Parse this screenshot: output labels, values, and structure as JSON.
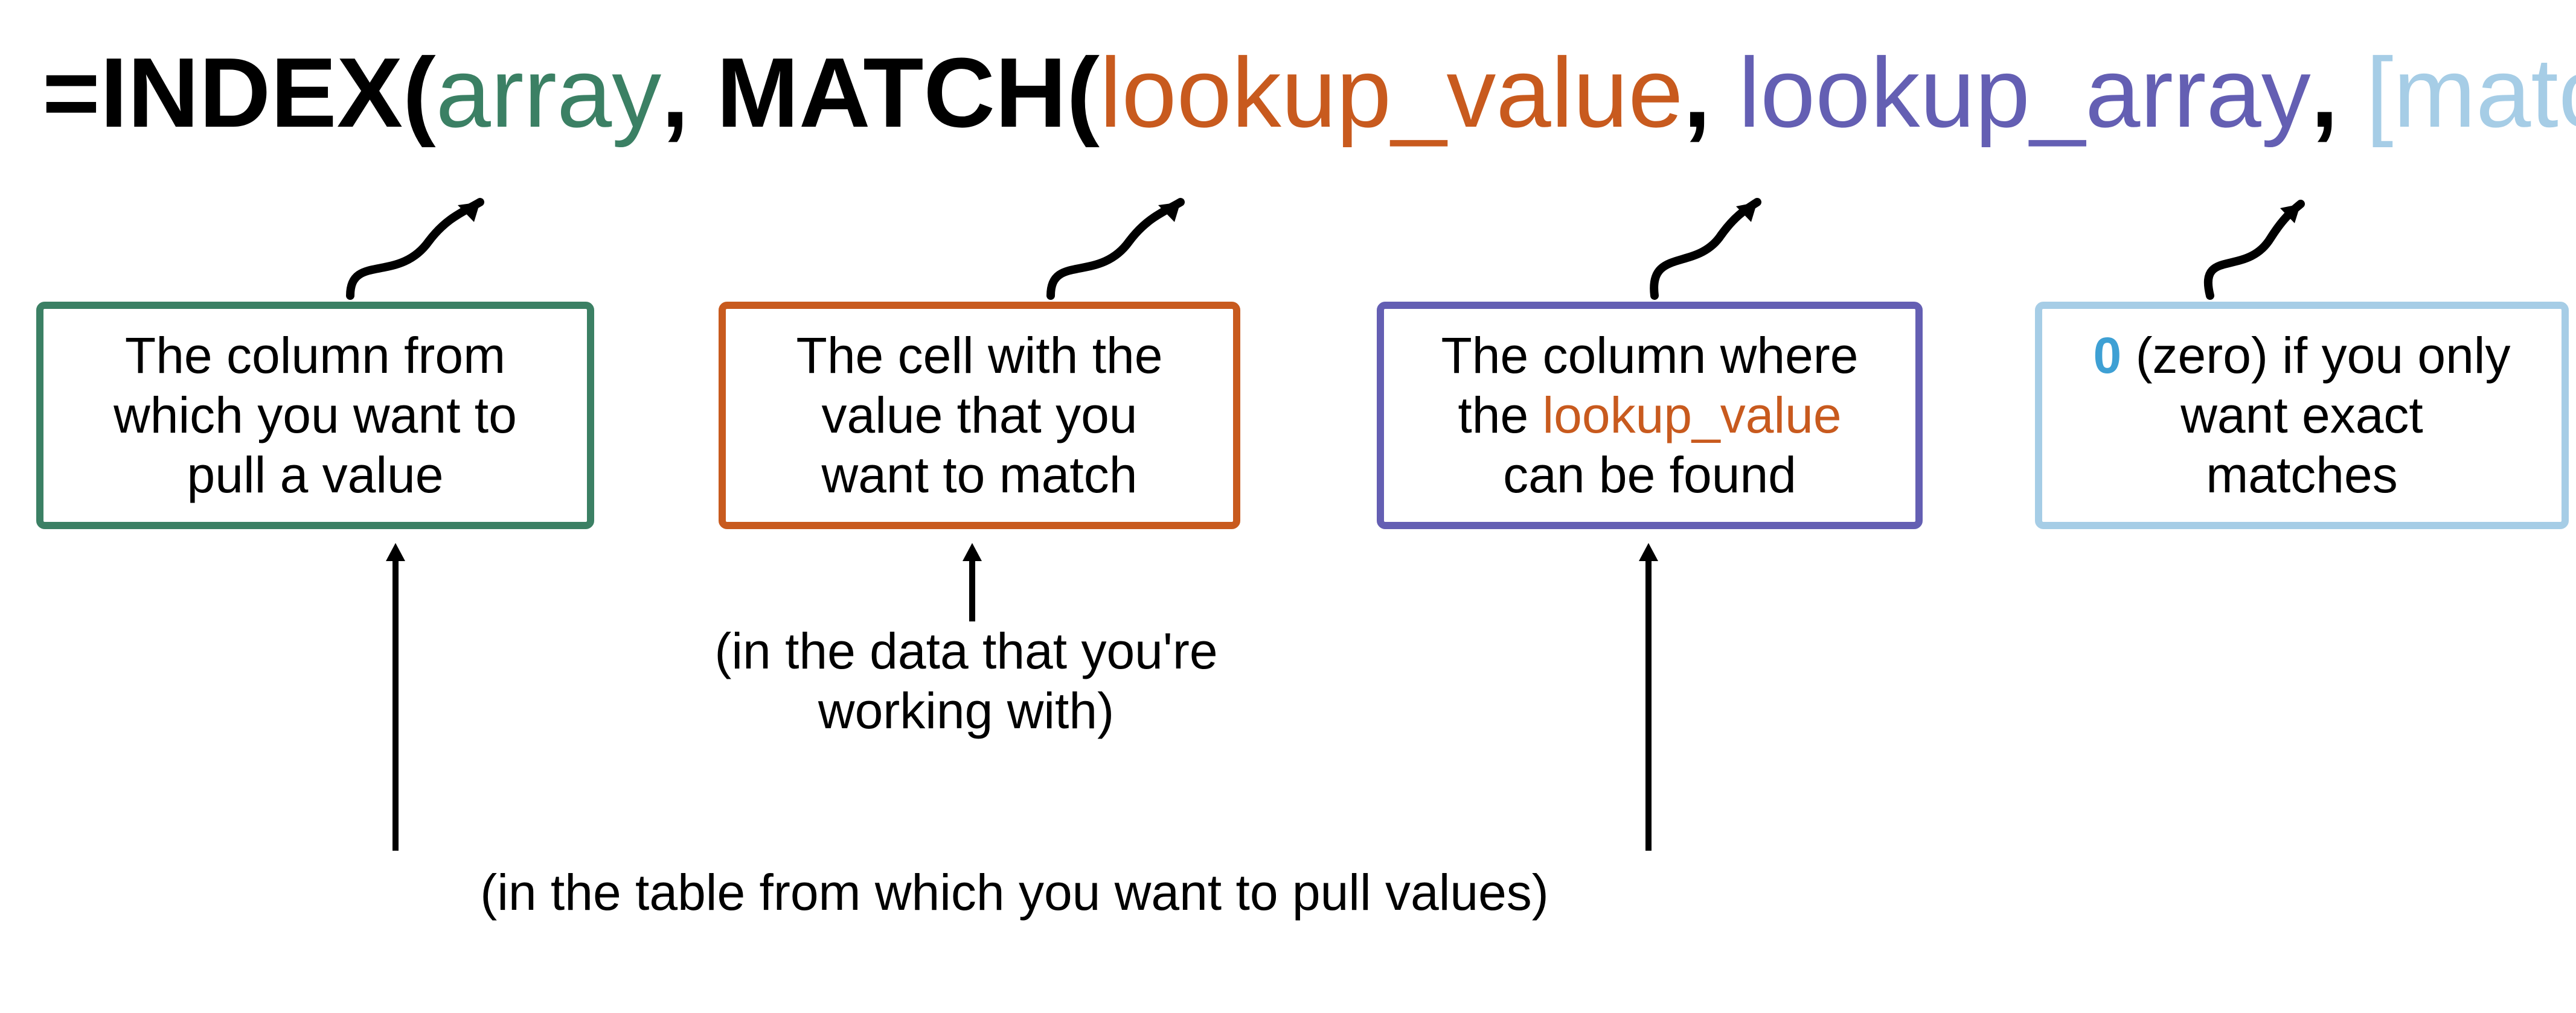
{
  "formula": {
    "eq": "=",
    "index": "INDEX(",
    "array": "array",
    "comma1": ", ",
    "match": "MATCH(",
    "lookup_value": "lookup_value",
    "comma2": ", ",
    "lookup_array": "lookup_array",
    "comma3": ", ",
    "match_type": "[match_type]",
    "close": "))"
  },
  "boxes": {
    "array": {
      "line1": "The column from",
      "line2": "which you want to",
      "line3": "pull a value"
    },
    "lookup_value": {
      "line1": "The cell with the",
      "line2": "value that you",
      "line3": "want to match"
    },
    "lookup_array": {
      "pre": "The column where",
      "mid_pre": "the ",
      "mid_hl": "lookup_value",
      "post": "can be found"
    },
    "match_type": {
      "zero": "0",
      "rest1": " (zero) if you only",
      "line2": "want exact",
      "line3": "matches"
    }
  },
  "captions": {
    "working_with": {
      "line1": "(in the data that you're",
      "line2": "working with)"
    },
    "pull_values": "(in the table from which you want to pull values)"
  },
  "colors": {
    "green": "#3b8064",
    "orange": "#c85a1e",
    "purple": "#645fb3",
    "light_blue": "#a6cde6",
    "light_blue_bold": "#3ea0d4"
  }
}
